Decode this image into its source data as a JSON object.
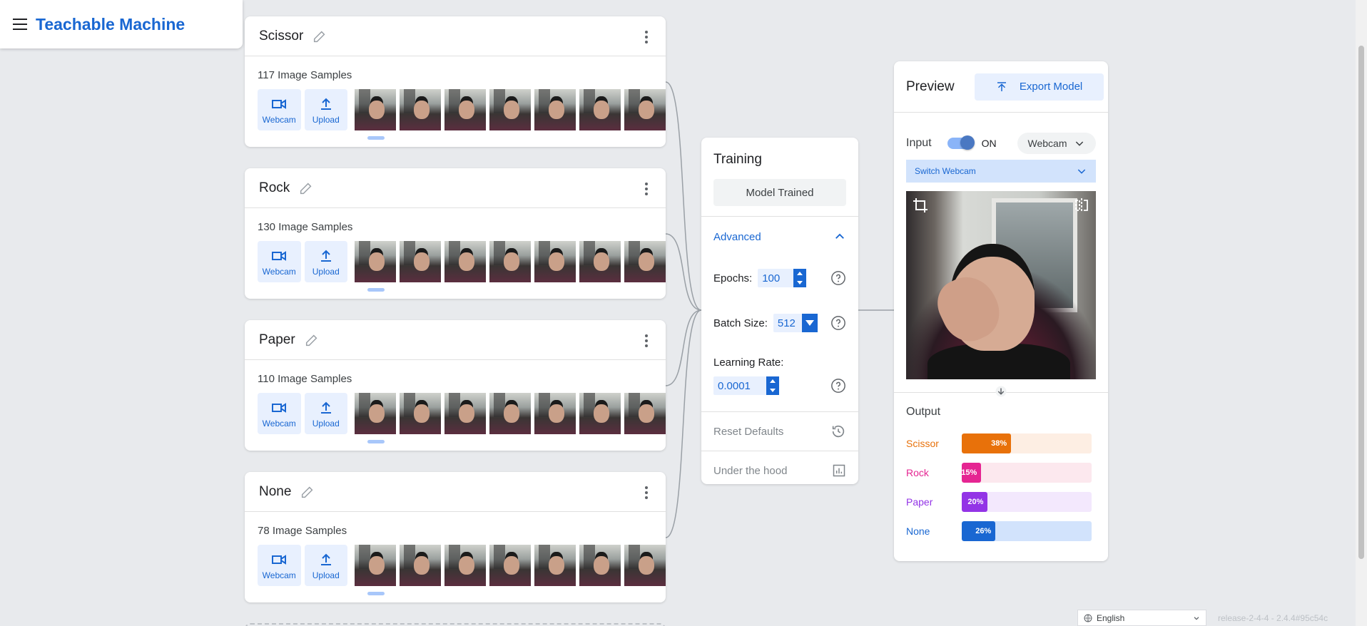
{
  "header": {
    "title": "Teachable Machine"
  },
  "classes": [
    {
      "name": "Scissor",
      "samples": "117 Image Samples",
      "webcam_label": "Webcam",
      "upload_label": "Upload"
    },
    {
      "name": "Rock",
      "samples": "130 Image Samples",
      "webcam_label": "Webcam",
      "upload_label": "Upload"
    },
    {
      "name": "Paper",
      "samples": "110 Image Samples",
      "webcam_label": "Webcam",
      "upload_label": "Upload"
    },
    {
      "name": "None",
      "samples": "78 Image Samples",
      "webcam_label": "Webcam",
      "upload_label": "Upload"
    }
  ],
  "training": {
    "title": "Training",
    "trained_label": "Model Trained",
    "advanced_label": "Advanced",
    "epochs_label": "Epochs:",
    "epochs_value": "100",
    "batch_label": "Batch Size:",
    "batch_value": "512",
    "lr_label": "Learning Rate:",
    "lr_value": "0.0001",
    "reset_label": "Reset Defaults",
    "hood_label": "Under the hood"
  },
  "preview": {
    "title": "Preview",
    "export_label": "Export Model",
    "input_label": "Input",
    "toggle_state": "ON",
    "source_label": "Webcam",
    "switch_label": "Switch Webcam",
    "output_title": "Output",
    "outputs": [
      {
        "label": "Scissor",
        "pct_text": "38%",
        "value": 0.38,
        "color": "#e8710a",
        "track": "#fdeee3"
      },
      {
        "label": "Rock",
        "pct_text": "15%",
        "value": 0.15,
        "color": "#e52592",
        "track": "#fce8ee"
      },
      {
        "label": "Paper",
        "pct_text": "20%",
        "value": 0.2,
        "color": "#9334e6",
        "track": "#f3e8fd"
      },
      {
        "label": "None",
        "pct_text": "26%",
        "value": 0.26,
        "color": "#1967d2",
        "track": "#d2e3fc"
      }
    ]
  },
  "footer": {
    "language": "English",
    "release": "release-2-4-4 - 2.4.4#95c54c"
  },
  "icons": {
    "menu": "hamburger-icon",
    "edit": "pencil-icon",
    "more": "more-vert-icon",
    "webcam": "videocam-icon",
    "upload": "upload-icon",
    "help": "help-circle-icon",
    "reset": "history-icon",
    "hood": "bar-chart-icon"
  }
}
